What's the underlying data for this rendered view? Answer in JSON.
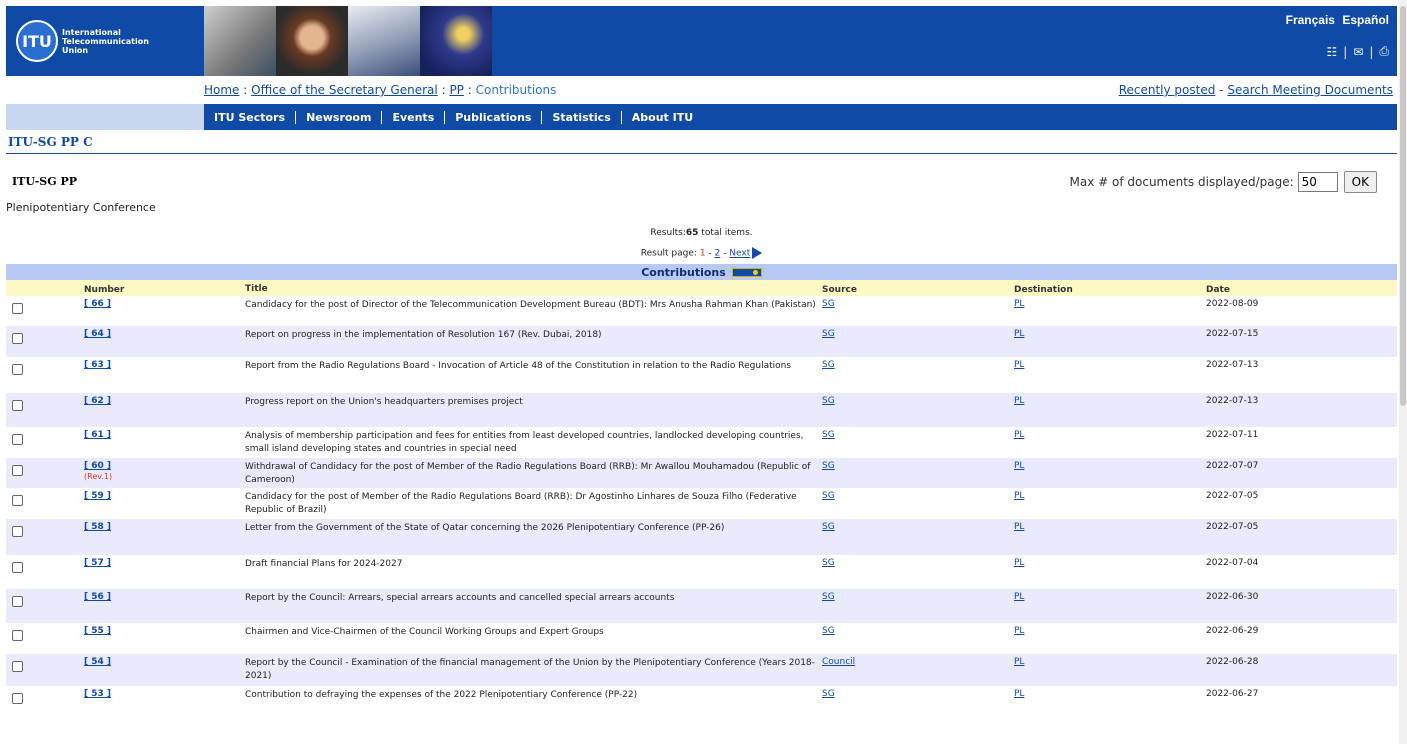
{
  "header": {
    "logo_abbrev": "ITU",
    "logo_lines": [
      "International",
      "Telecommunication",
      "Union"
    ],
    "languages": [
      "Français",
      "Español"
    ]
  },
  "breadcrumb": {
    "home": "Home",
    "sep1": ":",
    "office": "Office of the Secretary General",
    "sep2": ":",
    "pp": "PP",
    "sep3": ":",
    "current": "Contributions"
  },
  "quicklinks": {
    "recent": "Recently posted",
    "dash": "-",
    "search": "Search Meeting Documents"
  },
  "menu": [
    "ITU Sectors",
    "Newsroom",
    "Events",
    "Publications",
    "Statistics",
    "About ITU"
  ],
  "page_title": "ITU-SG PP  C",
  "section": {
    "title": "ITU-SG PP",
    "subtitle": "Plenipotentiary Conference"
  },
  "maxdocs": {
    "label": "Max # of documents displayed/page:",
    "value": "50",
    "ok": "OK"
  },
  "results": {
    "prefix": "Results:",
    "count": "65",
    "suffix": " total items.",
    "page_label": "Result page:",
    "page1": "1",
    "dash1": "-",
    "page2": "2",
    "dash2": "-",
    "next": "Next"
  },
  "table": {
    "caption": "Contributions",
    "columns": [
      "Number",
      "Title",
      "Source",
      "Destination",
      "Date"
    ],
    "rows": [
      {
        "number": "[ 66 ]",
        "rev": "",
        "title": "Candidacy for the post of Director of the Telecommunication Development Bureau (BDT): Mrs Anusha Rahman Khan (Pakistan)",
        "source": "SG",
        "destination": "PL",
        "date": "2022-08-09"
      },
      {
        "number": "[ 64 ]",
        "rev": "",
        "title": "Report on progress in the implementation of Resolution 167 (Rev. Dubai, 2018)",
        "source": "SG",
        "destination": "PL",
        "date": "2022-07-15"
      },
      {
        "number": "[ 63 ]",
        "rev": "",
        "title": "Report from the Radio Regulations Board - Invocation of Article 48 of the Constitution in relation to the Radio Regulations",
        "source": "SG",
        "destination": "PL",
        "date": "2022-07-13"
      },
      {
        "number": "[ 62 ]",
        "rev": "",
        "title": "Progress report on the Union's headquarters premises project",
        "source": "SG",
        "destination": "PL",
        "date": "2022-07-13"
      },
      {
        "number": "[ 61 ]",
        "rev": "",
        "title": "Analysis of membership participation and fees for entities from least developed countries, landlocked developing countries, small island developing states and countries in special need",
        "source": "SG",
        "destination": "PL",
        "date": "2022-07-11"
      },
      {
        "number": "[ 60 ]",
        "rev": "(Rev.1)",
        "title": "Withdrawal of Candidacy for the post of Member of the Radio Regulations Board (RRB): Mr Awallou Mouhamadou (Republic of Cameroon)",
        "source": "SG",
        "destination": "PL",
        "date": "2022-07-07"
      },
      {
        "number": "[ 59 ]",
        "rev": "",
        "title": "Candidacy for the post of Member of the Radio Regulations Board (RRB): Dr Agostinho Linhares de Souza Filho (Federative Republic of Brazil)",
        "source": "SG",
        "destination": "PL",
        "date": "2022-07-05"
      },
      {
        "number": "[ 58 ]",
        "rev": "",
        "title": "Letter from the Government of the State of Qatar concerning the 2026 Plenipotentiary Conference (PP-26)",
        "source": "SG",
        "destination": "PL",
        "date": "2022-07-05"
      },
      {
        "number": "[ 57 ]",
        "rev": "",
        "title": "Draft financial Plans for 2024-2027",
        "source": "SG",
        "destination": "PL",
        "date": "2022-07-04"
      },
      {
        "number": "[ 56 ]",
        "rev": "",
        "title": "Report by the Council: Arrears, special arrears accounts and cancelled special arrears accounts",
        "source": "SG",
        "destination": "PL",
        "date": "2022-06-30"
      },
      {
        "number": "[ 55 ]",
        "rev": "",
        "title": "Chairmen and Vice-Chairmen of the Council Working Groups and Expert Groups",
        "source": "SG",
        "destination": "PL",
        "date": "2022-06-29"
      },
      {
        "number": "[ 54 ]",
        "rev": "",
        "title": "Report by the Council - Examination of the financial management of the Union by the Plenipotentiary Conference (Years 2018-2021)",
        "source": "Council",
        "destination": "PL",
        "date": "2022-06-28"
      },
      {
        "number": "[ 53 ]",
        "rev": "",
        "title": "Contribution to defraying the expenses of the 2022 Plenipotentiary Conference (PP-22)",
        "source": "SG",
        "destination": "PL",
        "date": "2022-06-27"
      }
    ]
  }
}
